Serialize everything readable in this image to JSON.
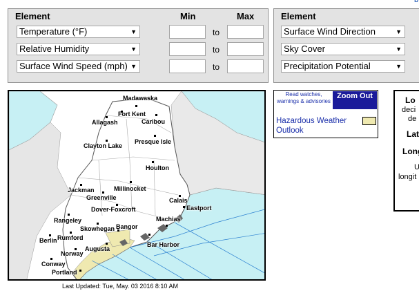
{
  "top_link": "b",
  "left_panel": {
    "element_header": "Element",
    "min_header": "Min",
    "max_header": "Max",
    "rows": [
      {
        "element": "Temperature (°F)",
        "to_label": "to",
        "min": "",
        "max": ""
      },
      {
        "element": "Relative Humidity",
        "to_label": "to",
        "min": "",
        "max": ""
      },
      {
        "element": "Surface Wind Speed (mph)",
        "to_label": "to",
        "min": "",
        "max": ""
      }
    ]
  },
  "right_panel": {
    "element_header": "Element",
    "rows": [
      {
        "element": "Surface Wind Direction"
      },
      {
        "element": "Sky Cover"
      },
      {
        "element": "Precipitation Potential"
      }
    ]
  },
  "map": {
    "cities": [
      "Madawaska",
      "Fort Kent",
      "Caribou",
      "Allagash",
      "Presque Isle",
      "Clayton Lake",
      "Houlton",
      "Millinocket",
      "Jackman",
      "Greenville",
      "Calais",
      "Eastport",
      "Dover-Foxcroft",
      "Machias",
      "Rangeley",
      "Skowhegan",
      "Bangor",
      "Rumford",
      "Berlin",
      "Augusta",
      "Bar Harbor",
      "Norway",
      "Conway",
      "Portland"
    ],
    "water_color": "#c7f0f4",
    "land_color": "#ffffff",
    "hazard_color": "#efe9b0",
    "last_updated": "Last Updated: Tue, May. 03 2016 8:10 AM"
  },
  "legend": {
    "watch_link": "Read watches, warnings & advisories",
    "zoom_out": "Zoom Out",
    "hazard_label": "Hazardous Weather Outlook",
    "hazard_color": "#efe9b0"
  },
  "info_box": {
    "line1": "Lo",
    "line2": "deci",
    "line3": "de",
    "line4": "Lat",
    "line5": "Long",
    "line6": "U",
    "line7": "longit"
  }
}
